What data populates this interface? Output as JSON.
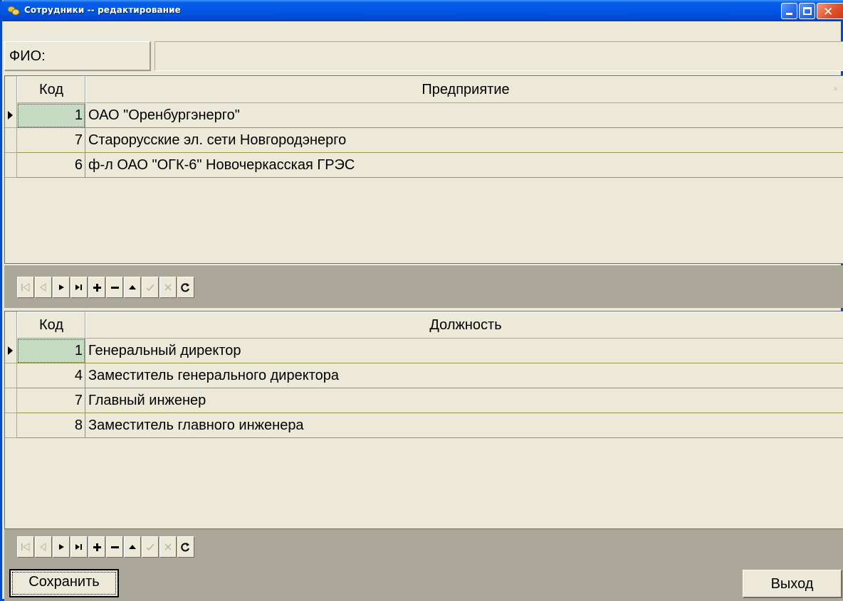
{
  "window": {
    "title": "Сотрудники -- редактирование"
  },
  "fio": {
    "label": "ФИО:",
    "value": ""
  },
  "enterprise_grid": {
    "columns": [
      "Код",
      "Предприятие"
    ],
    "rows": [
      {
        "code": "1",
        "name": "ОАО \"Оренбургэнерго\""
      },
      {
        "code": "7",
        "name": "Старорусские эл. сети Новгородэнерго"
      },
      {
        "code": "6",
        "name": "ф-л ОАО \"ОГК-6\" Новочеркасская ГРЭС"
      }
    ],
    "sort_mark": "▲"
  },
  "position_grid": {
    "columns": [
      "Код",
      "Должность"
    ],
    "rows": [
      {
        "code": "1",
        "name": "Генеральный директор"
      },
      {
        "code": "4",
        "name": "Заместитель генерального директора"
      },
      {
        "code": "7",
        "name": "Главный инженер"
      },
      {
        "code": "8",
        "name": "Заместитель главного инженера"
      }
    ]
  },
  "navigator": {
    "buttons": [
      "first",
      "prior",
      "next",
      "last",
      "insert",
      "delete",
      "edit",
      "post",
      "cancel",
      "refresh"
    ],
    "disabled": [
      "first",
      "prior",
      "post",
      "cancel"
    ]
  },
  "buttons": {
    "save": "Сохранить",
    "exit": "Выход"
  },
  "colors": {
    "title_bar": "#0058e6",
    "selected_cell": "#c6dcc2",
    "window_bg": "#ece9d8",
    "navigator_bg": "#aca899"
  }
}
